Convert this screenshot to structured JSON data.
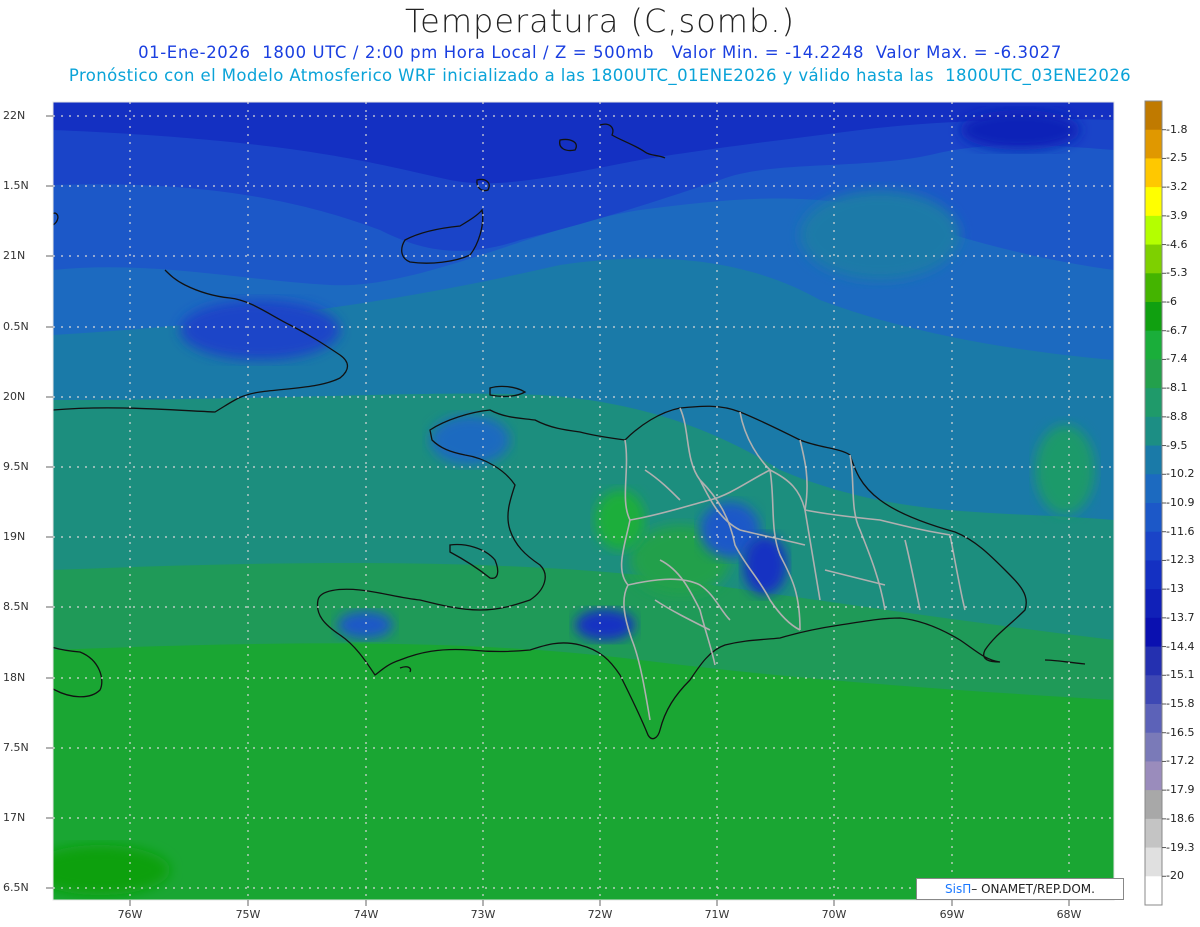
{
  "header": {
    "title": "Temperatura (C,somb.)",
    "line1": "01-Ene-2026  1800 UTC / 2:00 pm Hora Local / Z = 500mb   Valor Min. = -14.2248  Valor Max. = -6.3027",
    "line2": "Pronóstico con el Modelo Atmosferico WRF inicializado a las 1800UTC_01ENE2026 y válido hasta las  1800UTC_03ENE2026"
  },
  "axes": {
    "lat_labels": [
      "22N",
      "1.5N",
      "21N",
      "0.5N",
      "20N",
      "9.5N",
      "19N",
      "8.5N",
      "18N",
      "7.5N",
      "17N",
      "6.5N"
    ],
    "lon_labels": [
      "76W",
      "75W",
      "74W",
      "73W",
      "72W",
      "71W",
      "70W",
      "69W",
      "68W"
    ]
  },
  "colorbar": {
    "labels": [
      "-1.8",
      "-2.5",
      "-3.2",
      "-3.9",
      "-4.6",
      "-5.3",
      "-6",
      "-6.7",
      "-7.4",
      "-8.1",
      "-8.8",
      "-9.5",
      "-10.2",
      "-10.9",
      "-11.6",
      "-12.3",
      "-13",
      "-13.7",
      "-14.4",
      "-15.1",
      "-15.8",
      "-16.5",
      "-17.2",
      "-17.9",
      "-18.6",
      "-19.3",
      "-20"
    ],
    "colors": [
      "#c07a00",
      "#e09800",
      "#ffc800",
      "#ffff00",
      "#b4ff00",
      "#7ed000",
      "#44b400",
      "#10a010",
      "#1aae3a",
      "#23a04c",
      "#1f9a6a",
      "#1c8e84",
      "#1a7aa8",
      "#1c6ac0",
      "#1c58c8",
      "#1a44c8",
      "#1430c2",
      "#1020b8",
      "#0a10b0",
      "#2430b0",
      "#3e48b4",
      "#5c62b8",
      "#7a7ab8",
      "#9a8cbc",
      "#a8a8a8",
      "#c4c4c4",
      "#e0e0e0",
      "#ffffff"
    ]
  },
  "credit": {
    "logo": "SisΠ",
    "text": "– ONAMET/REP.DOM."
  }
}
